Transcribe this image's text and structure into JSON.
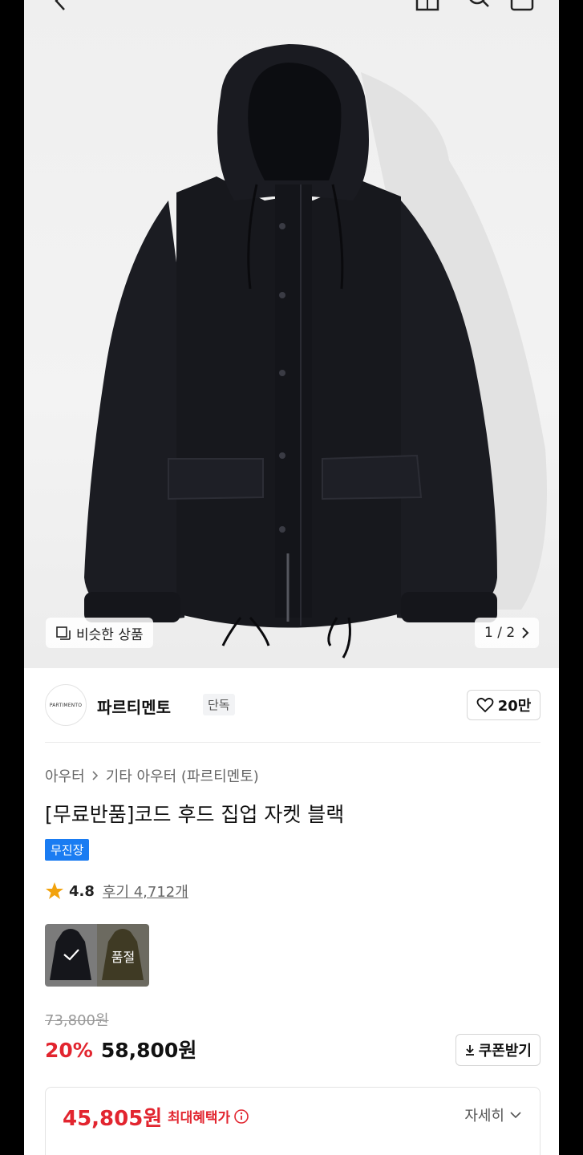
{
  "hero": {
    "similar_label": "비슷한 상품",
    "pager_text": "1 / 2"
  },
  "brand": {
    "logo_text": "PARTIMENTO",
    "name": "파르티멘토",
    "tag": "단독",
    "likes": "20만"
  },
  "breadcrumb": {
    "level1": "아우터",
    "level2": "기타 아우터 (파르티멘토)"
  },
  "product": {
    "title": "[무료반품]코드 후드 집업 자켓 블랙",
    "badge": "무진장",
    "rating": "4.8",
    "reviews": "후기 4,712개",
    "soldout_label": "품절",
    "original_price": "73,800원",
    "discount": "20%",
    "price": "58,800원",
    "coupon_label": "쿠폰받기"
  },
  "benefit": {
    "max_price": "45,805원",
    "max_label": "최대혜택가",
    "detail_label": "자세히"
  },
  "colors": {
    "accent_red": "#e2252f",
    "badge_blue": "#1a7cf2"
  }
}
